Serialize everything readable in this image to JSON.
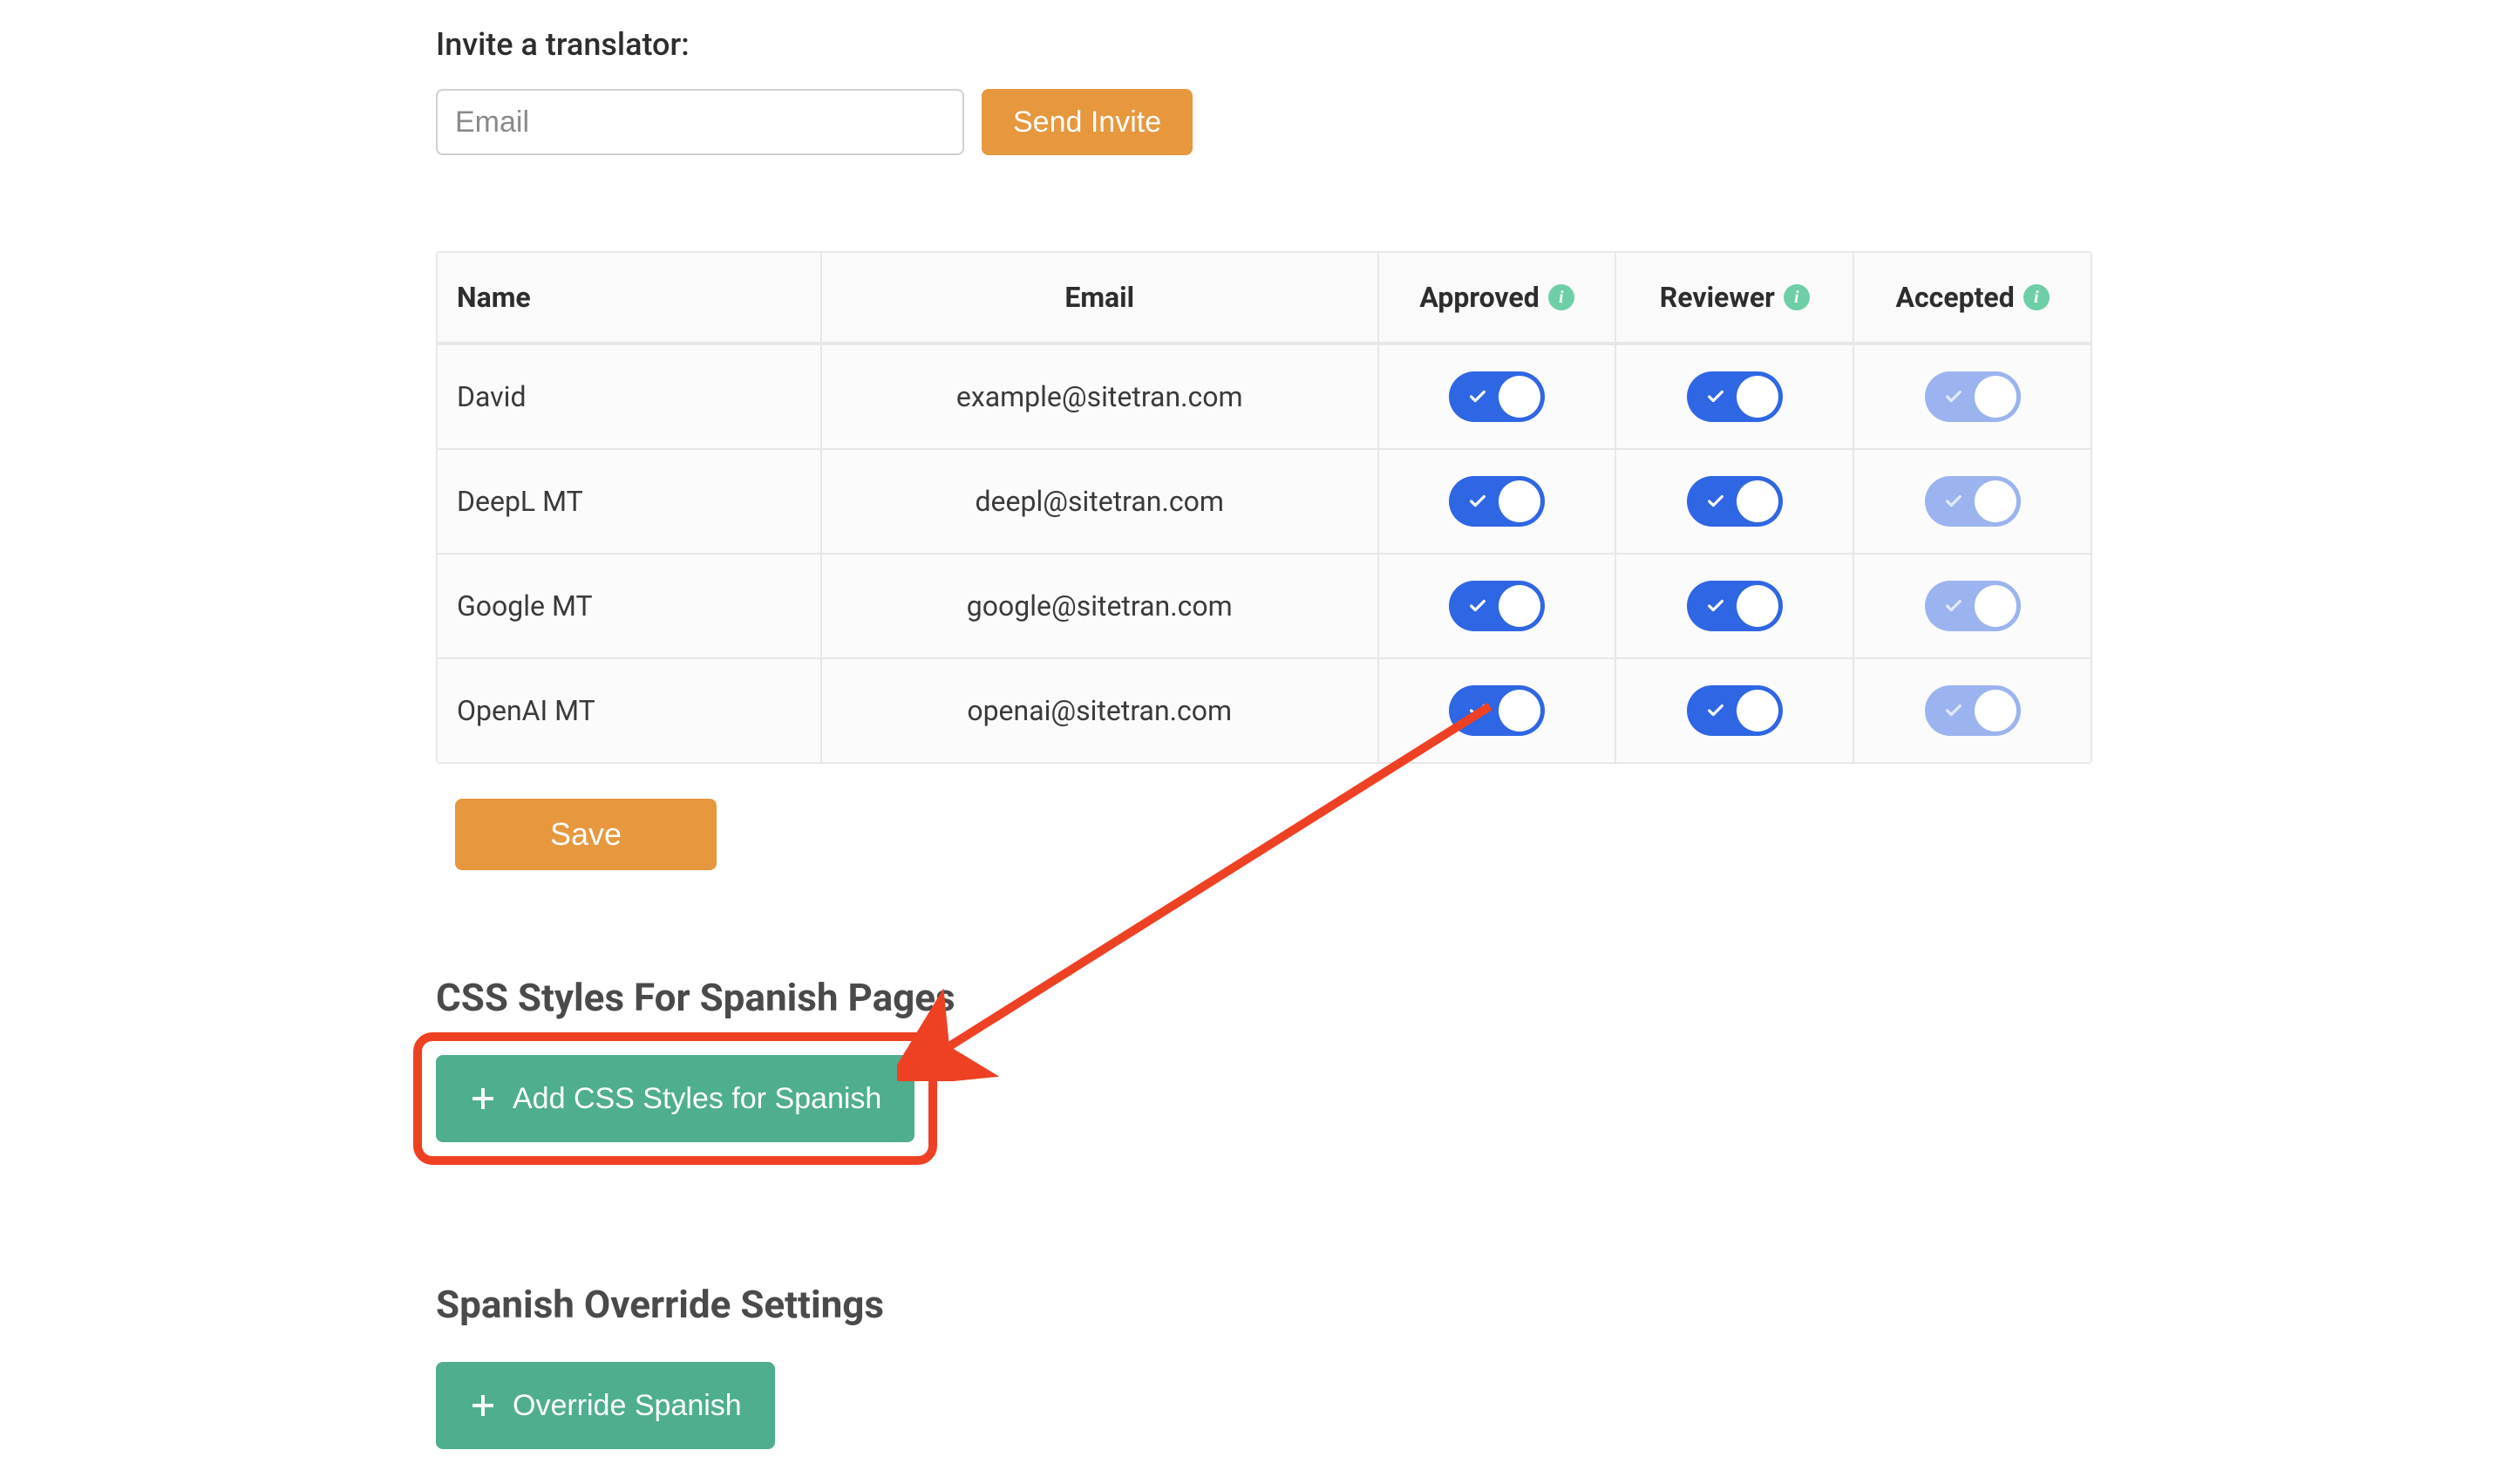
{
  "invite": {
    "label": "Invite a translator:",
    "placeholder": "Email",
    "send_label": "Send Invite"
  },
  "table": {
    "headers": {
      "name": "Name",
      "email": "Email",
      "approved": "Approved",
      "reviewer": "Reviewer",
      "accepted": "Accepted"
    },
    "rows": [
      {
        "name": "David",
        "email": "example@sitetran.com",
        "approved": true,
        "reviewer": true,
        "accepted": true
      },
      {
        "name": "DeepL MT",
        "email": "deepl@sitetran.com",
        "approved": true,
        "reviewer": true,
        "accepted": true
      },
      {
        "name": "Google MT",
        "email": "google@sitetran.com",
        "approved": true,
        "reviewer": true,
        "accepted": true
      },
      {
        "name": "OpenAI MT",
        "email": "openai@sitetran.com",
        "approved": true,
        "reviewer": true,
        "accepted": true
      }
    ]
  },
  "save_label": "Save",
  "css_section": {
    "heading": "CSS Styles For Spanish Pages",
    "add_label": "Add CSS Styles for Spanish"
  },
  "override_section": {
    "heading": "Spanish Override Settings",
    "button_label": "Override Spanish"
  },
  "colors": {
    "orange": "#e7973d",
    "teal": "#4eae8d",
    "toggle_blue": "#2f66e3",
    "toggle_blue_light": "#9bb4ef",
    "info_green": "#6ecfa7",
    "annotation_red": "#ee4124"
  }
}
